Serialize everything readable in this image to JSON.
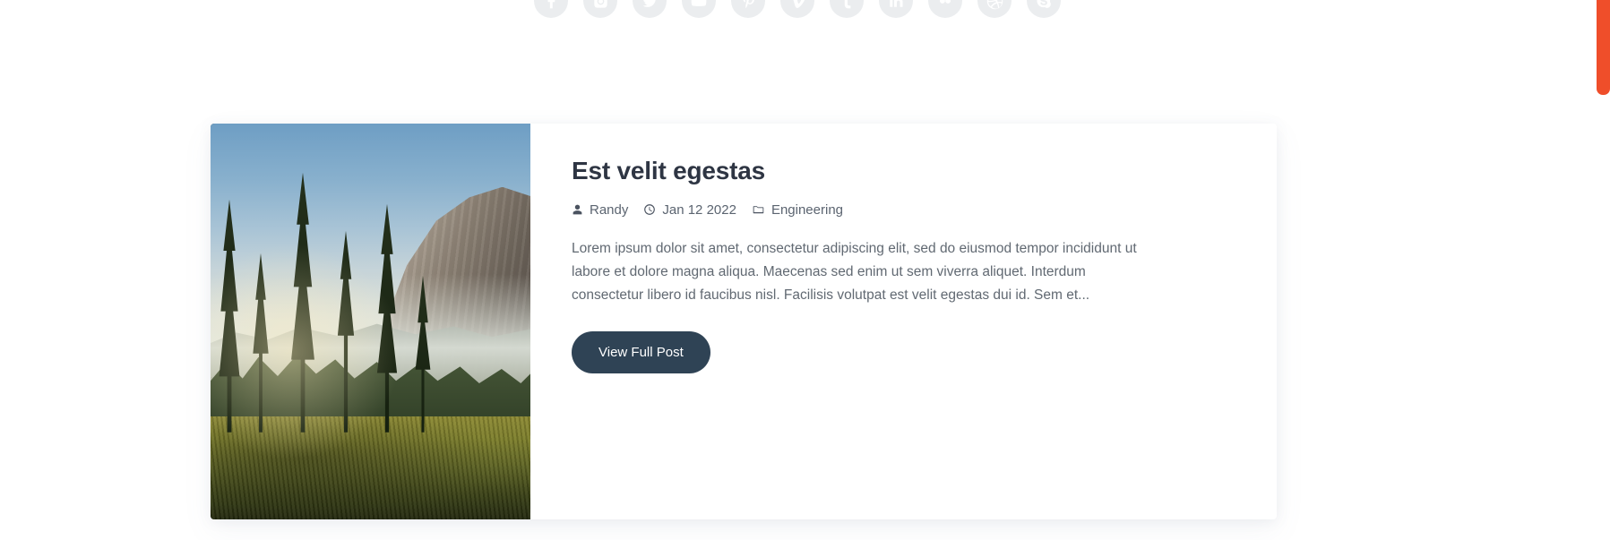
{
  "social_bar": {
    "name": "social-links",
    "items": [
      {
        "name": "facebook",
        "label": "Facebook",
        "glyph": "f"
      },
      {
        "name": "instagram",
        "label": "Instagram",
        "glyph": ""
      },
      {
        "name": "twitter",
        "label": "Twitter",
        "glyph": ""
      },
      {
        "name": "youtube",
        "label": "YouTube",
        "glyph": ""
      },
      {
        "name": "pinterest",
        "label": "Pinterest",
        "glyph": "P"
      },
      {
        "name": "vimeo",
        "label": "Vimeo",
        "glyph": "v"
      },
      {
        "name": "tumblr",
        "label": "Tumblr",
        "glyph": "t"
      },
      {
        "name": "linkedin",
        "label": "LinkedIn",
        "glyph": "in"
      },
      {
        "name": "flickr",
        "label": "Flickr",
        "glyph": ""
      },
      {
        "name": "dribbble",
        "label": "Dribbble",
        "glyph": ""
      },
      {
        "name": "skype",
        "label": "Skype",
        "glyph": "S"
      }
    ],
    "icon_background": "#ebedef",
    "icon_foreground": "#ffffff"
  },
  "post_card": {
    "title": "Est velit egestas",
    "image_alt": "Mountain valley with pine trees at sunrise",
    "meta": {
      "author_icon": "user-icon",
      "author": "Randy",
      "date_icon": "clock-icon",
      "date": "Jan 12 2022",
      "category_icon": "folder-icon",
      "category": "Engineering"
    },
    "excerpt": "Lorem ipsum dolor sit amet, consectetur adipiscing elit, sed do eiusmod tempor incididunt ut labore et dolore magna aliqua. Maecenas sed enim ut sem viverra aliquet. Interdum consectetur libero id faucibus nisl. Facilisis volutpat est velit egestas dui id. Sem et...",
    "cta_label": "View Full Post",
    "cta_color": "#2f4355",
    "title_color": "#2e3543",
    "text_color": "#616972"
  },
  "scrollbar": {
    "thumb_color": "#ef4e2a",
    "track_color": "#ffffff",
    "position": "top"
  }
}
